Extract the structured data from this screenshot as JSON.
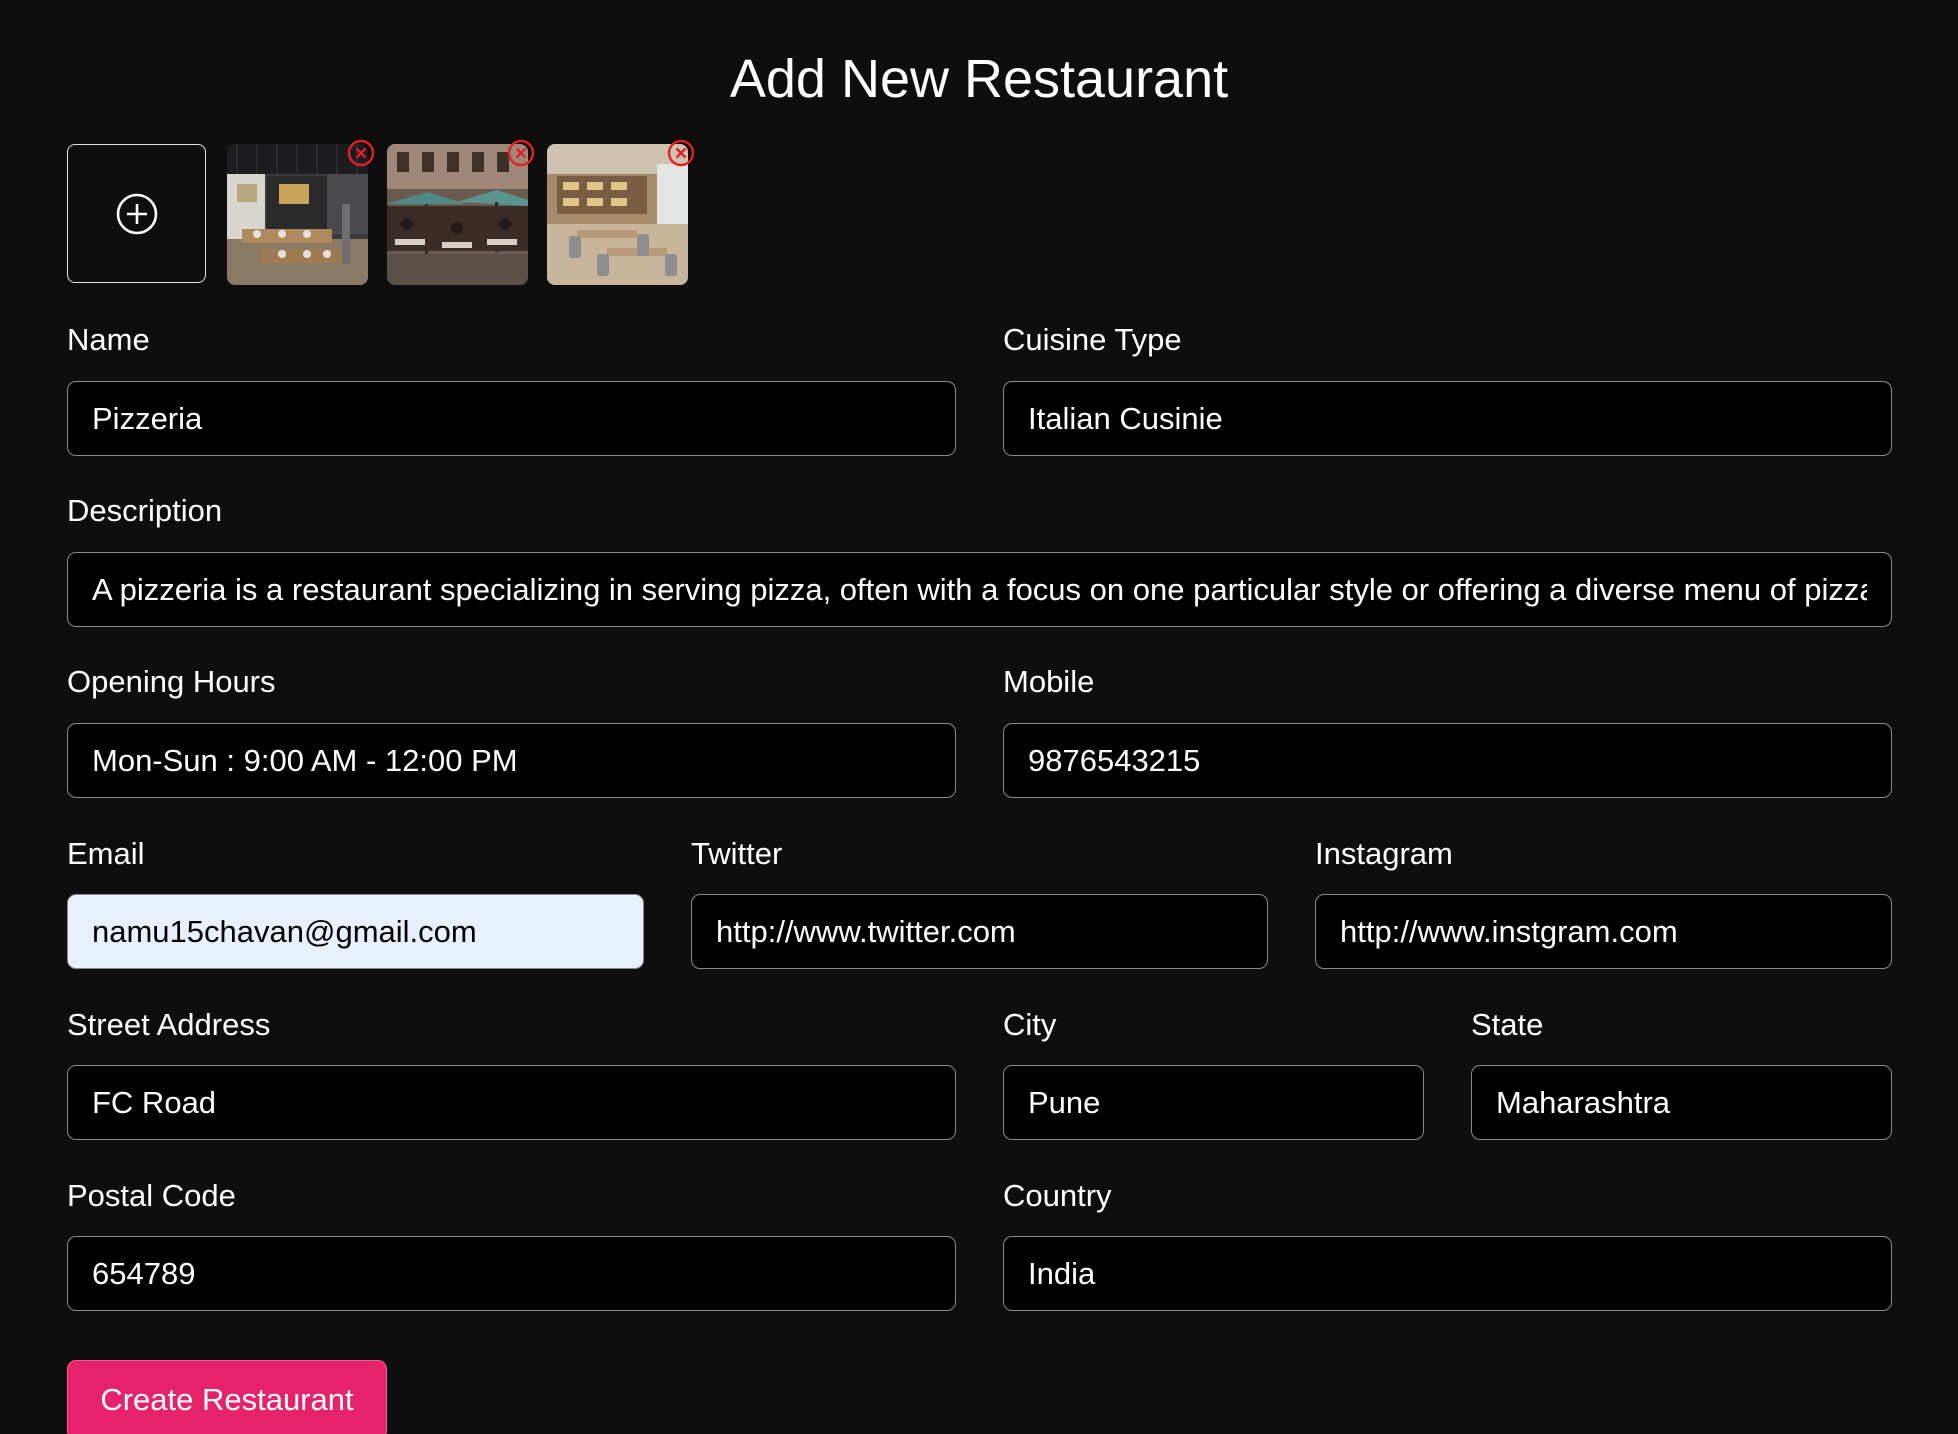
{
  "page_title": "Add New Restaurant",
  "images": {
    "add_icon": "plus-circle-icon",
    "remove_icon": "close-circle-icon",
    "remove_color": "#e0202a",
    "thumbnails": [
      {
        "name": "restaurant-photo-1"
      },
      {
        "name": "restaurant-photo-2"
      },
      {
        "name": "restaurant-photo-3"
      }
    ]
  },
  "form": {
    "name": {
      "label": "Name",
      "value": "Pizzeria"
    },
    "cuisine_type": {
      "label": "Cuisine Type",
      "value": "Italian Cusinie"
    },
    "description": {
      "label": "Description",
      "value": "A pizzeria is a restaurant specializing in serving pizza, often with a focus on one particular style or offering a diverse menu of pizza options."
    },
    "opening_hours": {
      "label": "Opening Hours",
      "value": "Mon-Sun : 9:00 AM - 12:00 PM"
    },
    "mobile": {
      "label": "Mobile",
      "value": "9876543215"
    },
    "email": {
      "label": "Email",
      "value": "namu15chavan@gmail.com"
    },
    "twitter": {
      "label": "Twitter",
      "value": "http://www.twitter.com"
    },
    "instagram": {
      "label": "Instagram",
      "value": "http://www.instgram.com"
    },
    "street_address": {
      "label": "Street Address",
      "value": "FC Road"
    },
    "city": {
      "label": "City",
      "value": "Pune"
    },
    "state": {
      "label": "State",
      "value": "Maharashtra"
    },
    "postal_code": {
      "label": "Postal Code",
      "value": "654789"
    },
    "country": {
      "label": "Country",
      "value": "India"
    }
  },
  "submit_label": "Create Restaurant",
  "colors": {
    "background": "#0e0e0e",
    "field_background": "#000000",
    "autofill_background": "#e8f0fe",
    "accent": "#e6236a"
  }
}
